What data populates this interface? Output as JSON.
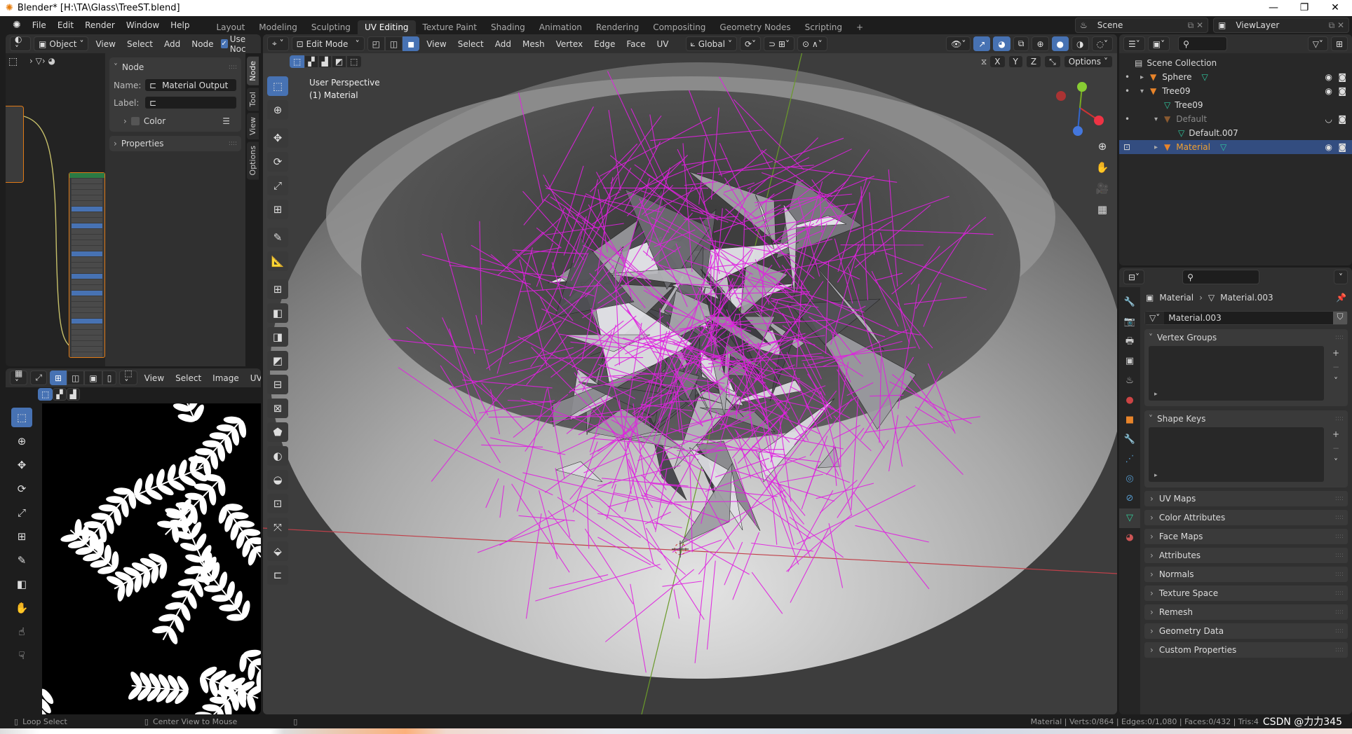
{
  "window": {
    "title": "Blender* [H:\\TA\\Glass\\TreeST.blend]",
    "minimize": "—",
    "maximize": "❐",
    "close": "✕"
  },
  "menu": {
    "items": [
      "File",
      "Edit",
      "Render",
      "Window",
      "Help"
    ]
  },
  "workspaces": {
    "tabs": [
      "Layout",
      "Modeling",
      "Sculpting",
      "UV Editing",
      "Texture Paint",
      "Shading",
      "Animation",
      "Rendering",
      "Compositing",
      "Geometry Nodes",
      "Scripting"
    ],
    "active": "UV Editing",
    "add": "+"
  },
  "scene": {
    "scene_name": "Scene",
    "view_layer": "ViewLayer"
  },
  "node_editor": {
    "header": {
      "mode": "Object",
      "menus": [
        "View",
        "Select",
        "Add",
        "Node"
      ],
      "use_nodes_label": "Use Noc",
      "use_nodes_checked": true
    },
    "sidebar": {
      "panel_title": "Node",
      "name_label": "Name:",
      "name_value": "Material Output",
      "label_label": "Label:",
      "label_value": "",
      "color_label": "Color",
      "properties_label": "Properties",
      "tabs": [
        "Node",
        "Tool",
        "View",
        "Options"
      ]
    }
  },
  "uv_editor": {
    "header": {
      "menus": [
        "View",
        "Select",
        "Image",
        "UV"
      ]
    }
  },
  "viewport": {
    "header": {
      "mode": "Edit Mode",
      "menus": [
        "View",
        "Select",
        "Add",
        "Mesh",
        "Vertex",
        "Edge",
        "Face",
        "UV"
      ],
      "orientation": "Global",
      "options": "Options",
      "axes": [
        "X",
        "Y",
        "Z"
      ]
    },
    "overlay_text": {
      "view": "User Perspective",
      "object": "(1) Material"
    },
    "colors": {
      "wire": "#e020e0",
      "x_axis": "#c0404a",
      "y_axis": "#6a9a2a"
    }
  },
  "outliner": {
    "root": "Scene Collection",
    "items": [
      {
        "label": "Sphere",
        "indent": 0,
        "expanded": false,
        "type": "object",
        "data": true
      },
      {
        "label": "Tree09",
        "indent": 0,
        "expanded": true,
        "type": "object",
        "data": false
      },
      {
        "label": "Tree09",
        "indent": 1,
        "type": "mesh"
      },
      {
        "label": "Default",
        "indent": 1,
        "expanded": true,
        "type": "object",
        "dimmed": true
      },
      {
        "label": "Default.007",
        "indent": 2,
        "type": "mesh"
      },
      {
        "label": "Material",
        "indent": 1,
        "expanded": false,
        "type": "object",
        "selected": true,
        "data": true
      }
    ]
  },
  "properties": {
    "breadcrumb": {
      "object": "Material",
      "data": "Material.003"
    },
    "datablock": "Material.003",
    "expanded_panels": [
      "Vertex Groups",
      "Shape Keys"
    ],
    "collapsed_panels": [
      "UV Maps",
      "Color Attributes",
      "Face Maps",
      "Attributes",
      "Normals",
      "Texture Space",
      "Remesh",
      "Geometry Data",
      "Custom Properties"
    ]
  },
  "statusbar": {
    "left_hint": "Loop Select",
    "middle_hint": "Center View to Mouse",
    "stats": "Material | Verts:0/864 | Edges:0/1,080 | Faces:0/432 | Tris:4",
    "watermark": "CSDN @力力345"
  }
}
